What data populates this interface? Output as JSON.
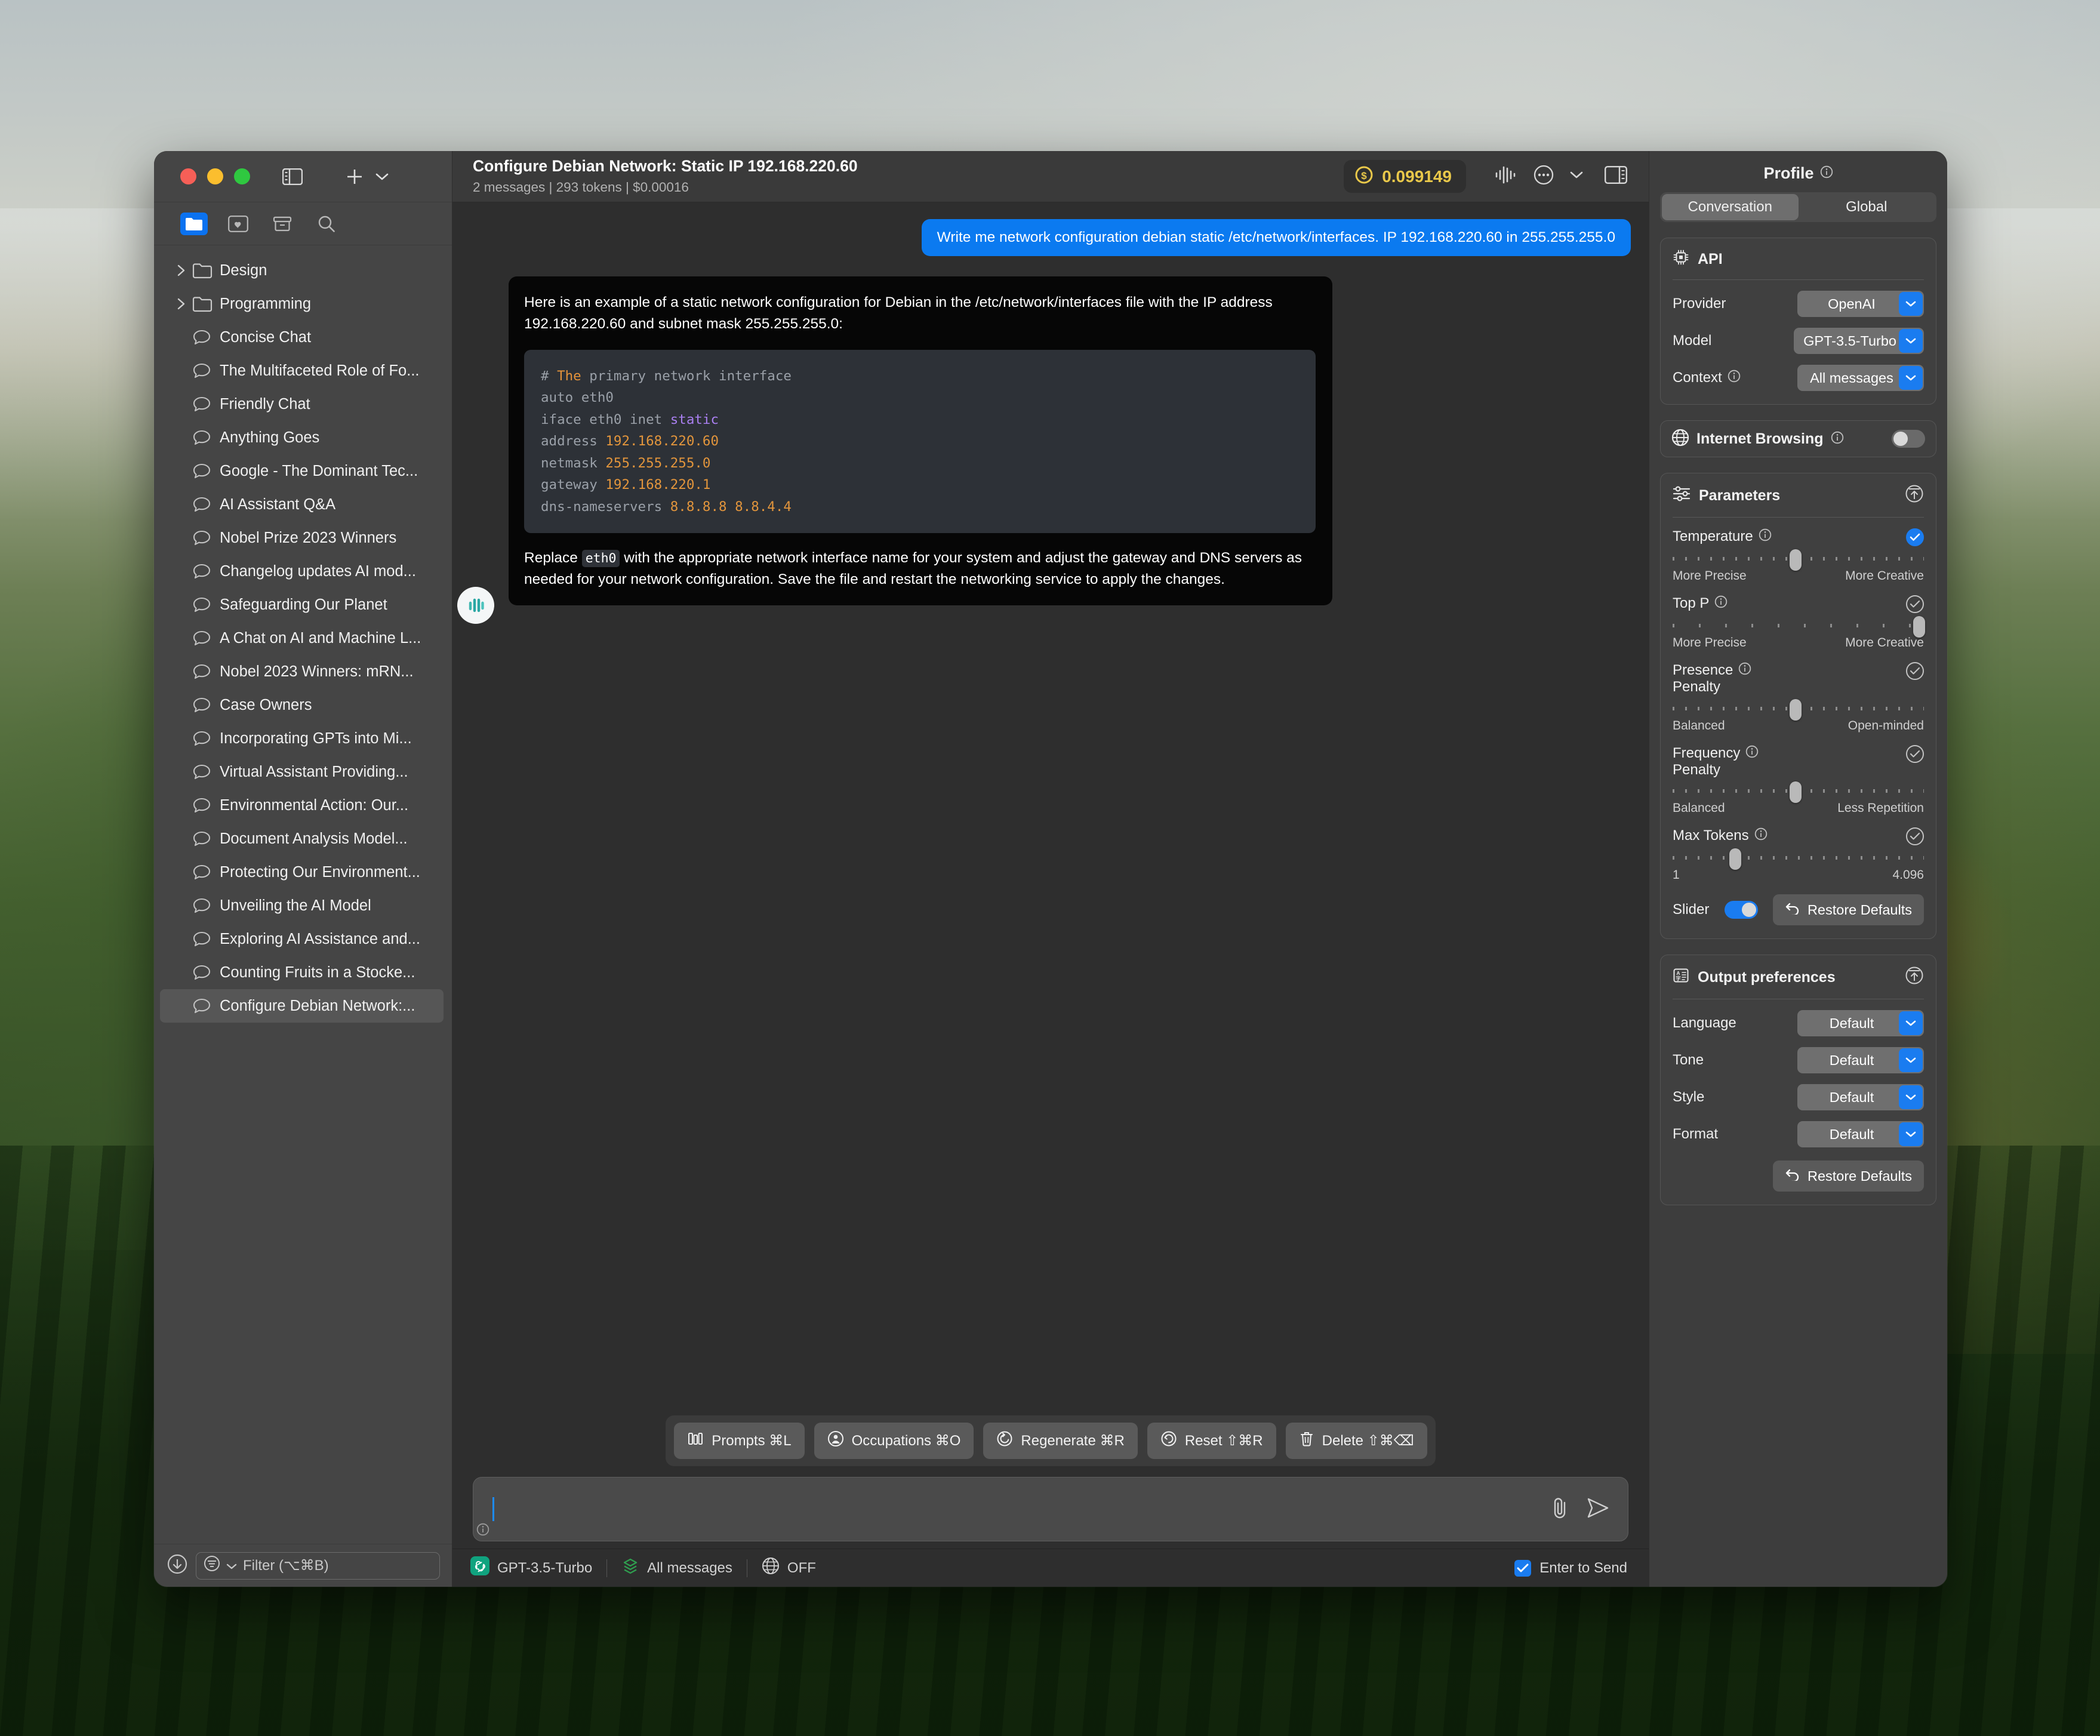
{
  "window": {
    "traffic_lights": [
      "close",
      "minimize",
      "zoom"
    ]
  },
  "sidebar": {
    "toolbar_icons": [
      "folder-icon",
      "favorites-icon",
      "archive-icon",
      "search-icon"
    ],
    "new_chat": "+",
    "groups": [
      {
        "label": "Design",
        "type": "folder"
      },
      {
        "label": "Programming",
        "type": "folder"
      }
    ],
    "chats": [
      {
        "label": "Concise Chat"
      },
      {
        "label": "The Multifaceted Role of Fo..."
      },
      {
        "label": "Friendly Chat"
      },
      {
        "label": "Anything Goes"
      },
      {
        "label": "Google - The Dominant Tec..."
      },
      {
        "label": "AI Assistant Q&A"
      },
      {
        "label": "Nobel Prize 2023 Winners"
      },
      {
        "label": "Changelog updates AI mod..."
      },
      {
        "label": "Safeguarding Our Planet"
      },
      {
        "label": "A Chat on AI and Machine L..."
      },
      {
        "label": "Nobel 2023 Winners: mRN..."
      },
      {
        "label": "Case Owners"
      },
      {
        "label": "Incorporating GPTs into Mi..."
      },
      {
        "label": "Virtual Assistant Providing..."
      },
      {
        "label": "Environmental Action: Our..."
      },
      {
        "label": "Document Analysis Model..."
      },
      {
        "label": "Protecting Our Environment..."
      },
      {
        "label": "Unveiling the AI Model"
      },
      {
        "label": "Exploring AI Assistance and..."
      },
      {
        "label": "Counting Fruits in a Stocke..."
      },
      {
        "label": "Configure Debian Network:...",
        "selected": true
      }
    ],
    "filter_placeholder": "Filter (⌥⌘B)"
  },
  "header": {
    "title": "Configure Debian Network: Static IP 192.168.220.60",
    "subtitle": "2 messages  |   293 tokens  |   $0.00016",
    "cost_value": "0.099149",
    "cost_color": "#e9c84a"
  },
  "conversation": {
    "user_message": "Write me network configuration debian static /etc/network/interfaces. IP 192.168.220.60 in 255.255.255.0",
    "ai_intro": "Here is an example of a static network configuration for Debian in the /etc/network/interfaces file with the IP address 192.168.220.60 and subnet mask 255.255.255.0:",
    "code_lines": [
      {
        "parts": [
          {
            "t": "# ",
            "c": "tk-com"
          },
          {
            "t": "The",
            "c": "tk-the"
          },
          {
            "t": " primary network interface",
            "c": "tk-com"
          }
        ]
      },
      {
        "parts": [
          {
            "t": "auto eth0",
            "c": "tk-com"
          }
        ]
      },
      {
        "parts": [
          {
            "t": "iface eth0 inet ",
            "c": "tk-com"
          },
          {
            "t": "static",
            "c": "tk-kw"
          }
        ]
      },
      {
        "parts": [
          {
            "t": "address ",
            "c": "tk-com"
          },
          {
            "t": "192.168.220.60",
            "c": "tk-num"
          }
        ]
      },
      {
        "parts": [
          {
            "t": "netmask ",
            "c": "tk-com"
          },
          {
            "t": "255.255.255.0",
            "c": "tk-num"
          }
        ]
      },
      {
        "parts": [
          {
            "t": "gateway ",
            "c": "tk-com"
          },
          {
            "t": "192.168.220.1",
            "c": "tk-num"
          }
        ]
      },
      {
        "parts": [
          {
            "t": "dns-nameservers ",
            "c": "tk-com"
          },
          {
            "t": "8.8.8.8 8.8.4.4",
            "c": "tk-num"
          }
        ]
      }
    ],
    "ai_outro_before": "Replace ",
    "ai_outro_code": "eth0",
    "ai_outro_after": " with the appropriate network interface name for your system and adjust the gateway and DNS servers as needed for your network configuration. Save the file and restart the networking service to apply the changes."
  },
  "actions": [
    {
      "icon": "prompts-icon",
      "label": "Prompts ⌘L"
    },
    {
      "icon": "occupations-icon",
      "label": "Occupations ⌘O"
    },
    {
      "icon": "regenerate-icon",
      "label": "Regenerate ⌘R"
    },
    {
      "icon": "reset-icon",
      "label": "Reset ⇧⌘R"
    },
    {
      "icon": "trash-icon",
      "label": "Delete ⇧⌘⌫"
    }
  ],
  "composer": {
    "value": "",
    "placeholder": ""
  },
  "statusbar": {
    "model": "GPT-3.5-Turbo",
    "context": "All messages",
    "browsing": "OFF",
    "enter_to_send": "Enter to Send",
    "enter_to_send_checked": true
  },
  "profile": {
    "title": "Profile",
    "tabs": [
      {
        "label": "Conversation",
        "active": true
      },
      {
        "label": "Global",
        "active": false
      }
    ],
    "api": {
      "title": "API",
      "rows": [
        {
          "label": "Provider",
          "value": "OpenAI",
          "info": false
        },
        {
          "label": "Model",
          "value": "GPT-3.5-Turbo",
          "info": false
        },
        {
          "label": "Context",
          "value": "All messages",
          "info": true
        }
      ]
    },
    "internet_browsing": {
      "label": "Internet Browsing",
      "enabled": false
    },
    "parameters": {
      "title": "Parameters",
      "items": [
        {
          "label": "Temperature",
          "enabled": true,
          "pos": 49,
          "left": "More Precise",
          "right": "More Creative",
          "ticks": "dense"
        },
        {
          "label": "Top P",
          "enabled": false,
          "pos": 98,
          "left": "More Precise",
          "right": "More Creative",
          "ticks": "plain"
        },
        {
          "label": "Presence\nPenalty",
          "enabled": false,
          "pos": 49,
          "left": "Balanced",
          "right": "Open-minded",
          "ticks": "dense"
        },
        {
          "label": "Frequency\nPenalty",
          "enabled": false,
          "pos": 49,
          "left": "Balanced",
          "right": "Less Repetition",
          "ticks": "dense"
        },
        {
          "label": "Max Tokens",
          "enabled": false,
          "pos": 25,
          "left": "1",
          "right": "4.096",
          "ticks": "dense"
        }
      ],
      "slider_label": "Slider",
      "slider_on": true,
      "restore_label": "Restore Defaults"
    },
    "output_preferences": {
      "title": "Output preferences",
      "rows": [
        {
          "label": "Language",
          "value": "Default"
        },
        {
          "label": "Tone",
          "value": "Default"
        },
        {
          "label": "Style",
          "value": "Default"
        },
        {
          "label": "Format",
          "value": "Default"
        }
      ],
      "restore_label": "Restore Defaults"
    }
  }
}
